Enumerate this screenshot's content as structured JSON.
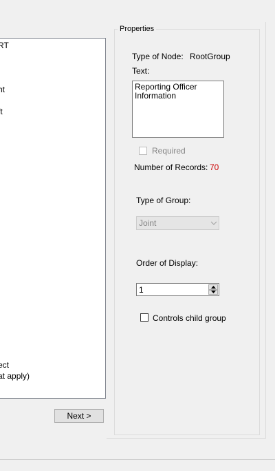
{
  "tree": {
    "fragments": [
      "RT",
      "nt",
      "ft",
      "ect",
      "at apply)"
    ]
  },
  "buttons": {
    "next_label": "Next >"
  },
  "properties": {
    "title": "Properties",
    "type_of_node_label": "Type of Node:",
    "type_of_node_value": "RootGroup",
    "text_label": "Text:",
    "text_value": "Reporting Officer\nInformation",
    "required_label": "Required",
    "required_checked": false,
    "number_of_records_label": "Number of Records:",
    "number_of_records_value": "70",
    "type_of_group_label": "Type of Group:",
    "type_of_group_value": "Joint",
    "order_of_display_label": "Order of Display:",
    "order_of_display_value": "1",
    "controls_child_group_label": "Controls child group",
    "controls_child_group_checked": false
  },
  "colors": {
    "records_value": "#cc0000",
    "disabled_text": "#838383"
  }
}
